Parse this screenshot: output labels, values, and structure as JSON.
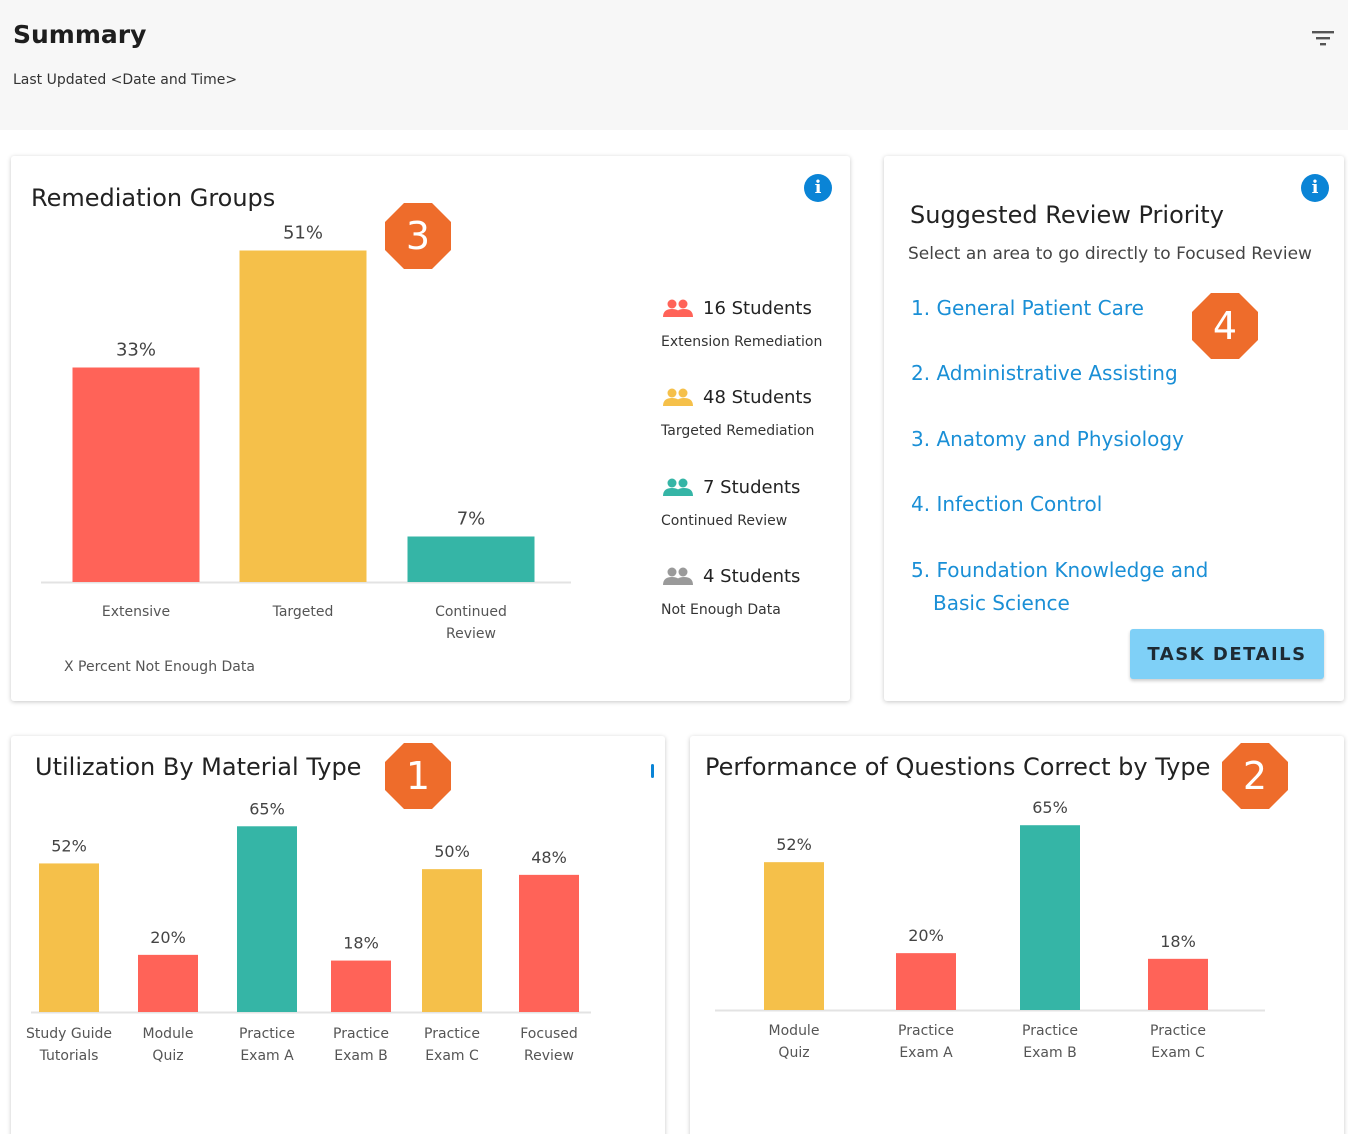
{
  "header": {
    "title": "Summary",
    "last_updated": "Last Updated <Date and Time>",
    "filter_icon": "filter-icon"
  },
  "colors": {
    "red": "#ff6358",
    "yellow": "#f5c04a",
    "teal": "#35b5a6",
    "gray": "#9a9a9a",
    "badge": "#ee6c2b",
    "link": "#1a8fd6",
    "info": "#0a84d6",
    "button": "#7fd0f7"
  },
  "remediation": {
    "title": "Remediation Groups",
    "badge": "3",
    "info_icon": "info-icon",
    "note": "X Percent Not Enough Data",
    "legend": [
      {
        "count": "16 Students",
        "desc": "Extension Remediation",
        "color": "#ff6358",
        "icon": "users-icon"
      },
      {
        "count": "48 Students",
        "desc": "Targeted Remediation",
        "color": "#f5c04a",
        "icon": "users-icon"
      },
      {
        "count": "7 Students",
        "desc": "Continued Review",
        "color": "#35b5a6",
        "icon": "users-icon"
      },
      {
        "count": "4 Students",
        "desc": "Not Enough Data",
        "color": "#9a9a9a",
        "icon": "users-icon"
      }
    ]
  },
  "review": {
    "title": "Suggested Review Priority",
    "subtitle": "Select an area to go directly to Focused Review",
    "badge": "4",
    "info_icon": "info-icon",
    "items": [
      {
        "label": "1. General Patient Care"
      },
      {
        "label": "2. Administrative Assisting"
      },
      {
        "label": "3. Anatomy and Physiology"
      },
      {
        "label": "4. Infection Control"
      },
      {
        "label": "5. Foundation Knowledge and",
        "cont": "Basic Science"
      }
    ],
    "button": "TASK DETAILS"
  },
  "utilization": {
    "title": "Utilization By Material Type",
    "badge": "1"
  },
  "performance": {
    "title": "Performance of Questions Correct by Type",
    "badge": "2"
  },
  "chart_data": [
    {
      "type": "bar",
      "categories": [
        "Extensive",
        "Targeted",
        "Continued Review"
      ],
      "values": [
        33,
        51,
        7
      ],
      "value_labels": [
        "33%",
        "51%",
        "7%"
      ],
      "colors": [
        "#ff6358",
        "#f5c04a",
        "#35b5a6"
      ],
      "ylim": [
        0,
        60
      ]
    },
    {
      "type": "bar",
      "title": "Utilization By Material Type",
      "categories": [
        [
          "Study Guide",
          "Tutorials"
        ],
        [
          "Module",
          "Quiz"
        ],
        [
          "Practice",
          "Exam A"
        ],
        [
          "Practice",
          "Exam B"
        ],
        [
          "Practice",
          "Exam C"
        ],
        [
          "Focused",
          "Review"
        ]
      ],
      "values": [
        52,
        20,
        65,
        18,
        50,
        48
      ],
      "value_labels": [
        "52%",
        "20%",
        "65%",
        "18%",
        "50%",
        "48%"
      ],
      "colors": [
        "#f5c04a",
        "#ff6358",
        "#35b5a6",
        "#ff6358",
        "#f5c04a",
        "#ff6358"
      ],
      "ylim": [
        0,
        70
      ]
    },
    {
      "type": "bar",
      "title": "Performance of Questions Correct by Type",
      "categories": [
        [
          "Module",
          "Quiz"
        ],
        [
          "Practice",
          "Exam A"
        ],
        [
          "Practice",
          "Exam B"
        ],
        [
          "Practice",
          "Exam C"
        ]
      ],
      "values": [
        52,
        20,
        65,
        18
      ],
      "value_labels": [
        "52%",
        "20%",
        "65%",
        "18%"
      ],
      "colors": [
        "#f5c04a",
        "#ff6358",
        "#35b5a6",
        "#ff6358"
      ],
      "ylim": [
        0,
        70
      ]
    }
  ]
}
